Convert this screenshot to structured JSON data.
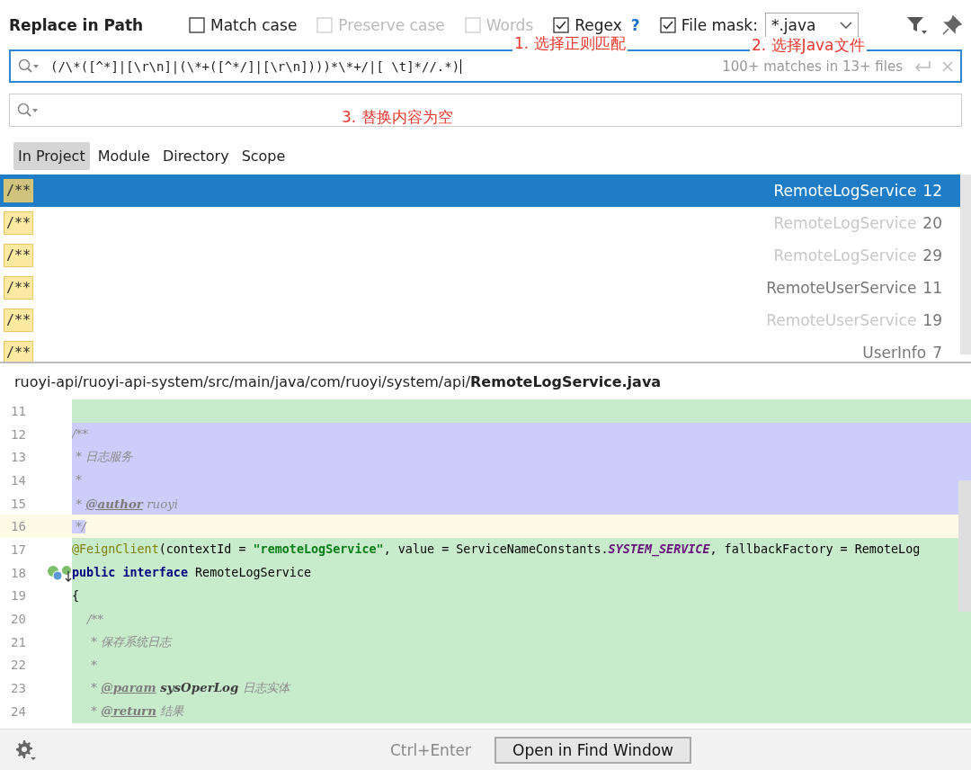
{
  "window": {
    "title": "Replace in Path"
  },
  "options": [
    {
      "label": "Match case",
      "checked": false,
      "disabled": false
    },
    {
      "label": "Preserve case",
      "checked": false,
      "disabled": true
    },
    {
      "label": "Words",
      "checked": false,
      "disabled": true
    },
    {
      "label": "Regex",
      "checked": true,
      "disabled": false,
      "help": "?"
    }
  ],
  "file_mask": {
    "label": "File mask:",
    "checked": true,
    "value": "*.java"
  },
  "search": {
    "value": "(/\\*([^*]|[\\r\\n]|(\\*+([^*/]|[\\r\\n])))*\\*+/|[ \\t]*//.*)",
    "matches": "100+ matches in 13+ files"
  },
  "annotations": [
    {
      "text": "1. 选择正则匹配"
    },
    {
      "text": "2. 选择Java文件"
    },
    {
      "text": "3. 替换内容为空"
    }
  ],
  "scopes": [
    {
      "label": "In Project",
      "selected": true
    },
    {
      "label": "Module",
      "selected": false
    },
    {
      "label": "Directory",
      "selected": false
    },
    {
      "label": "Scope",
      "selected": false
    }
  ],
  "results": [
    {
      "snippet": "/**",
      "file": "RemoteLogService",
      "line": "12",
      "selected": true,
      "dimmed": false
    },
    {
      "snippet": "/**",
      "file": "RemoteLogService",
      "line": "20",
      "selected": false,
      "dimmed": true
    },
    {
      "snippet": "/**",
      "file": "RemoteLogService",
      "line": "29",
      "selected": false,
      "dimmed": true
    },
    {
      "snippet": "/**",
      "file": "RemoteUserService",
      "line": "11",
      "selected": false,
      "dimmed": false
    },
    {
      "snippet": "/**",
      "file": "RemoteUserService",
      "line": "19",
      "selected": false,
      "dimmed": true
    },
    {
      "snippet": "/**",
      "file": "UserInfo",
      "line": "7",
      "selected": false,
      "dimmed": false
    }
  ],
  "preview": {
    "path": "ruoyi-api/ruoyi-api-system/src/main/java/com/ruoyi/system/api/**RemoteLogService.java**",
    "lines": [
      {
        "number": "11",
        "kind": "changed"
      },
      {
        "number": "12",
        "kind": "match",
        "segments": [
          {
            "kind": "comment",
            "text": "/**"
          }
        ]
      },
      {
        "number": "13",
        "kind": "match",
        "segments": [
          {
            "kind": "comment",
            "text": " * 日志服务"
          }
        ]
      },
      {
        "number": "14",
        "kind": "match",
        "segments": [
          {
            "kind": "comment",
            "text": " *"
          }
        ]
      },
      {
        "number": "15",
        "kind": "match",
        "segments": [
          {
            "kind": "comment",
            "text": " * "
          },
          {
            "kind": "doctag",
            "text": "@author"
          },
          {
            "kind": "comment",
            "text": " ruoyi"
          }
        ]
      },
      {
        "number": "16",
        "kind": "caret",
        "segments": [
          {
            "kind": "comment",
            "text": " */"
          }
        ]
      },
      {
        "number": "17",
        "kind": "changed",
        "segments": [
          {
            "kind": "annotation",
            "text": "@FeignClient"
          },
          {
            "kind": "plain",
            "text": "(contextId = "
          },
          {
            "kind": "string",
            "text": "\"remoteLogService\""
          },
          {
            "kind": "plain",
            "text": ", value = ServiceNameConstants."
          },
          {
            "kind": "constant",
            "text": "SYSTEM_SERVICE"
          },
          {
            "kind": "plain",
            "text": ", fallbackFactory = RemoteLog"
          }
        ]
      },
      {
        "number": "18",
        "kind": "changed",
        "gutter": true,
        "segments": [
          {
            "kind": "keyword",
            "text": "public interface"
          },
          {
            "kind": "plain",
            "text": " RemoteLogService"
          }
        ]
      },
      {
        "number": "19",
        "kind": "changed",
        "segments": [
          {
            "kind": "plain",
            "text": "{"
          }
        ]
      },
      {
        "number": "20",
        "kind": "changed",
        "segments": [
          {
            "kind": "comment",
            "text": "    /**"
          }
        ]
      },
      {
        "number": "21",
        "kind": "changed",
        "segments": [
          {
            "kind": "comment",
            "text": "     * 保存系统日志"
          }
        ]
      },
      {
        "number": "22",
        "kind": "changed",
        "segments": [
          {
            "kind": "comment",
            "text": "     *"
          }
        ]
      },
      {
        "number": "23",
        "kind": "changed",
        "segments": [
          {
            "kind": "comment",
            "text": "     * "
          },
          {
            "kind": "doctag",
            "text": "@param"
          },
          {
            "kind": "param",
            "text": " sysOperLog"
          },
          {
            "kind": "comment",
            "text": " 日志实体"
          }
        ]
      },
      {
        "number": "24",
        "kind": "changed",
        "segments": [
          {
            "kind": "comment",
            "text": "     * "
          },
          {
            "kind": "doctag",
            "text": "@return"
          },
          {
            "kind": "comment",
            "text": " 结果"
          }
        ]
      }
    ]
  },
  "footer": {
    "shortcut": "Ctrl+Enter",
    "button": "Open in Find Window"
  }
}
